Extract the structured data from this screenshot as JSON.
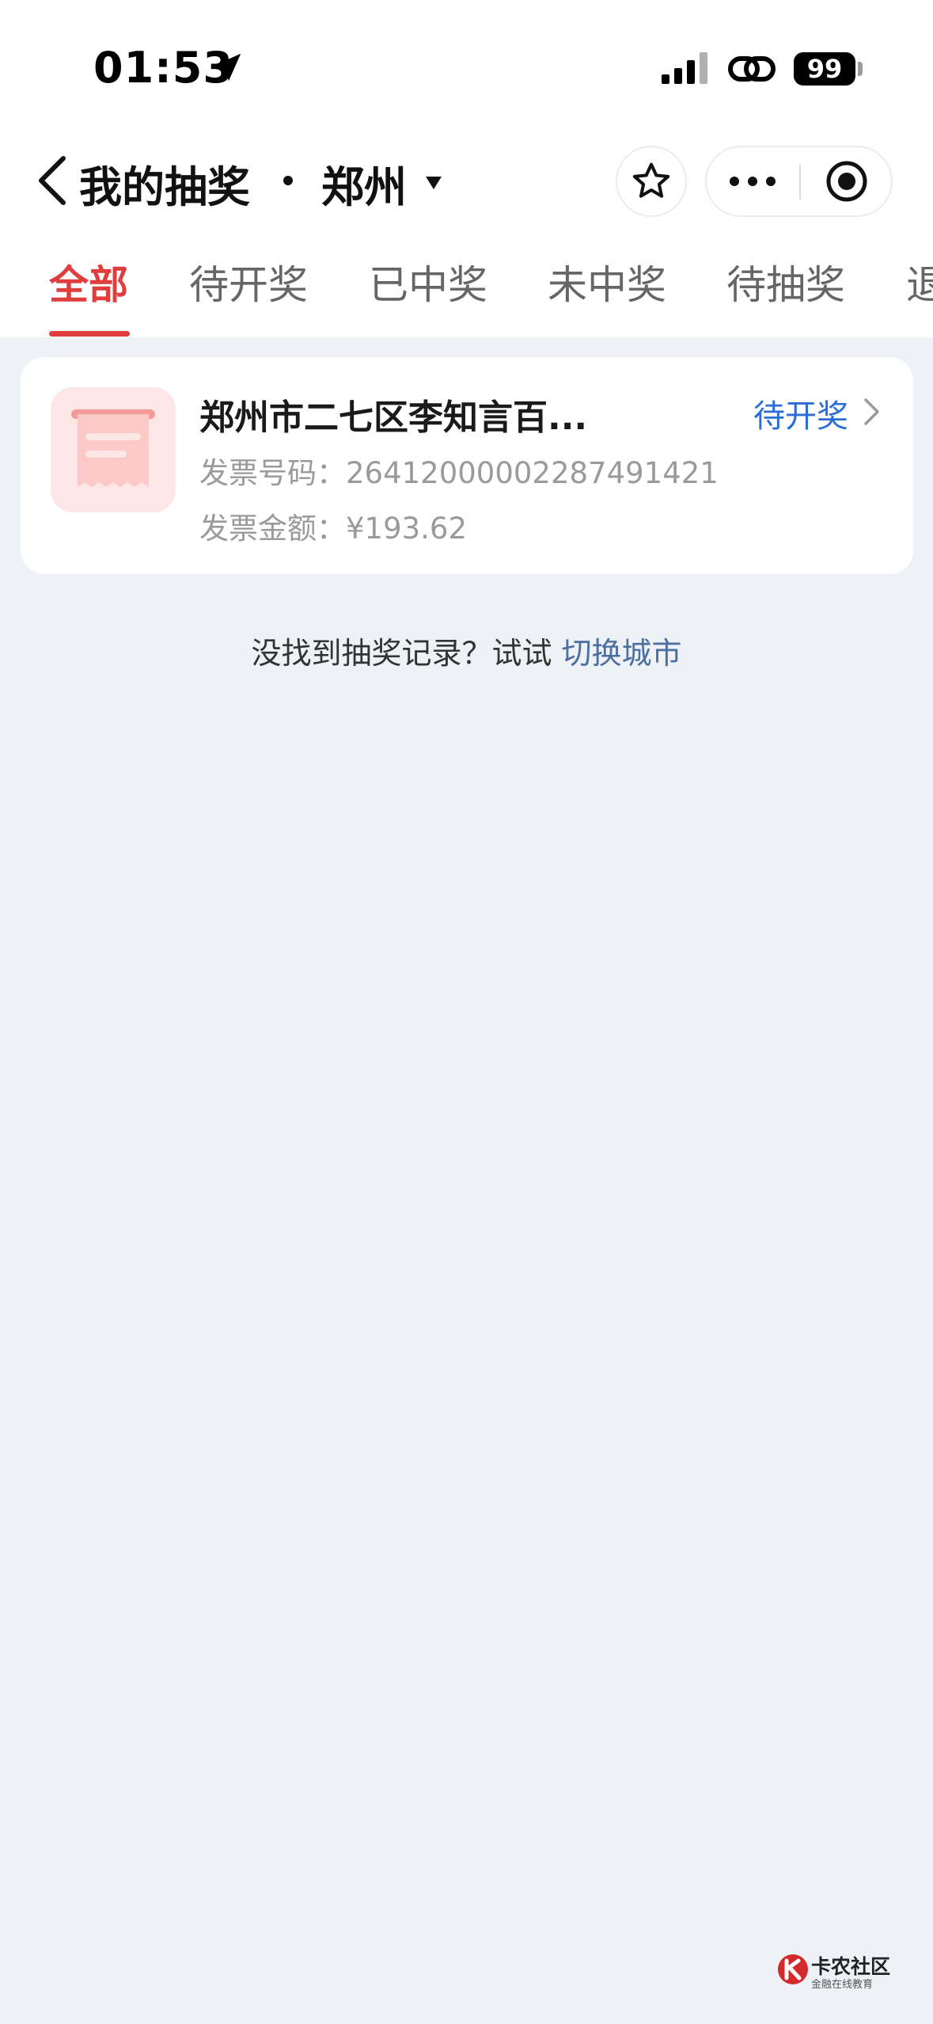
{
  "status_bar": {
    "time": "01:53",
    "battery": "99",
    "icons": [
      "location-arrow-icon",
      "cellular-signal-icon",
      "link-icon",
      "battery-icon"
    ]
  },
  "nav": {
    "title": "我的抽奖",
    "city": "郑州",
    "icons": [
      "back-icon",
      "caret-down-icon",
      "star-icon",
      "more-icon",
      "close-target-icon"
    ]
  },
  "tabs": [
    {
      "label": "全部",
      "active": true
    },
    {
      "label": "待开奖",
      "active": false
    },
    {
      "label": "已中奖",
      "active": false
    },
    {
      "label": "未中奖",
      "active": false
    },
    {
      "label": "待抽奖",
      "active": false
    },
    {
      "label": "退",
      "active": false
    }
  ],
  "records": [
    {
      "shop": "郑州市二七区李知言百...",
      "status": "待开奖",
      "invoice_number_label": "发票号码：",
      "invoice_number": "26412000002287491421",
      "invoice_amount_label": "发票金额：",
      "invoice_amount": "¥193.62",
      "icon": "receipt-icon"
    }
  ],
  "hint": {
    "text": "没找到抽奖记录？试试 ",
    "link": "切换城市"
  },
  "watermark": {
    "title": "卡农社区",
    "subtitle": "金融在线教育"
  },
  "colors": {
    "accent_red": "#e03d3d",
    "status_blue": "#2a6dd6",
    "link_blue": "#4a6fa0",
    "page_background": "#eef1f6"
  }
}
